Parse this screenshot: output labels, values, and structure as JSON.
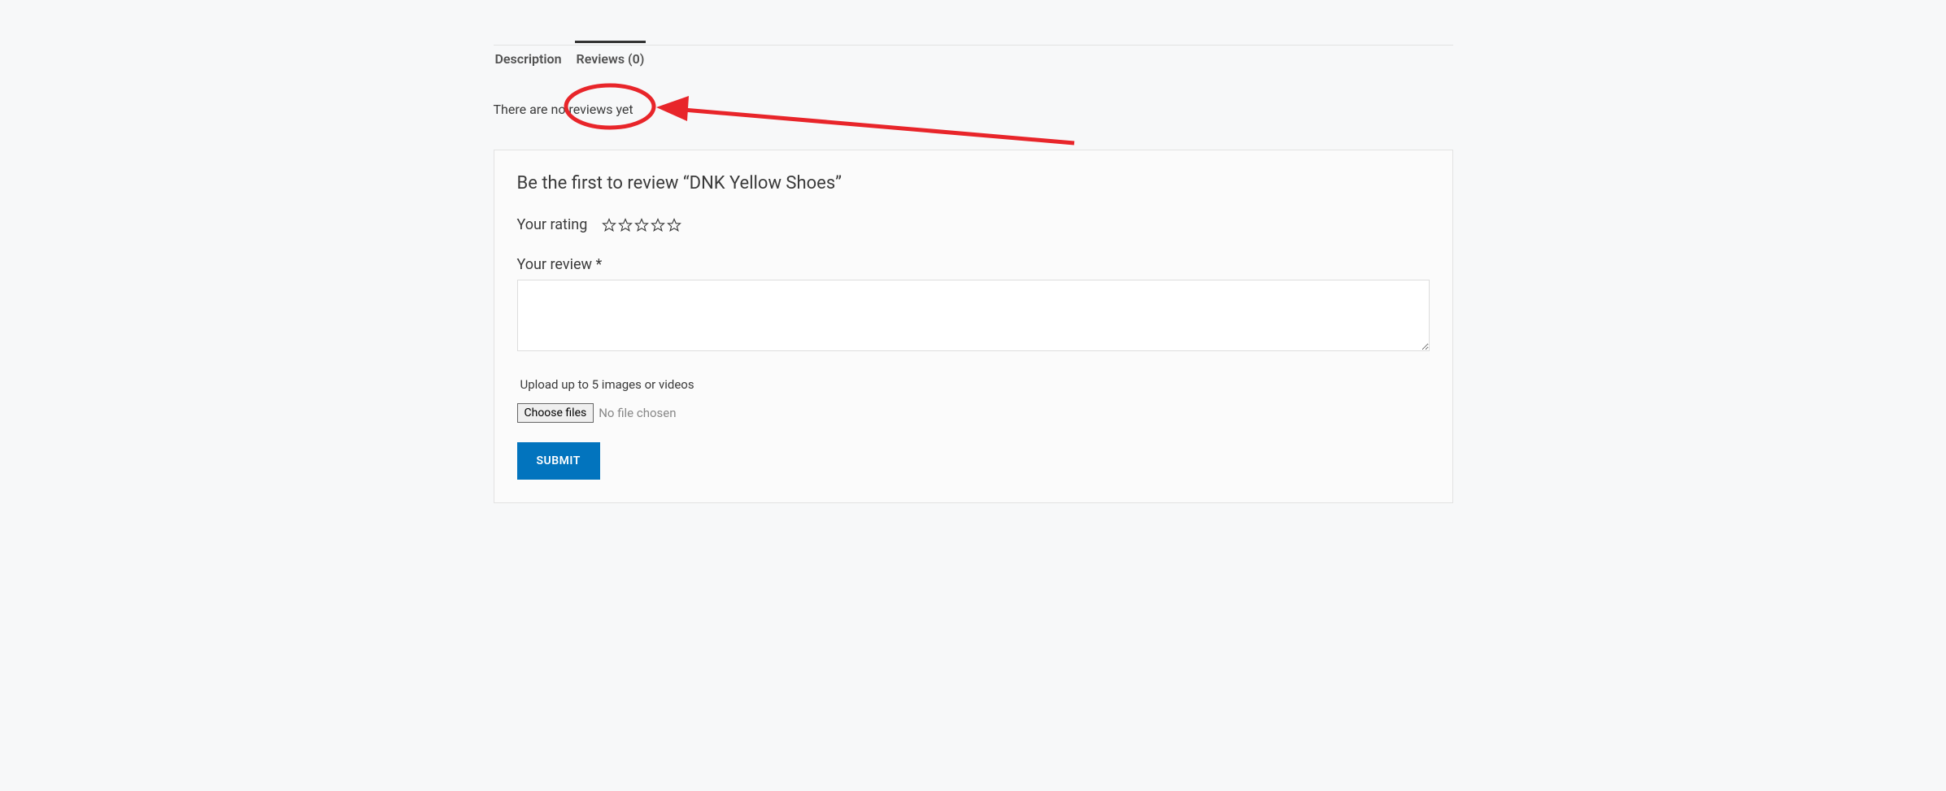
{
  "tabs": {
    "description": "Description",
    "reviews": "Reviews (0)"
  },
  "no_reviews_text": "There are no reviews yet",
  "review_form": {
    "title": "Be the first to review “DNK Yellow Shoes”",
    "rating_label": "Your rating",
    "review_label": "Your review *",
    "upload_label": "Upload up to 5 images or videos",
    "choose_files_label": "Choose files",
    "no_file_text": "No file chosen",
    "submit_label": "SUBMIT"
  }
}
